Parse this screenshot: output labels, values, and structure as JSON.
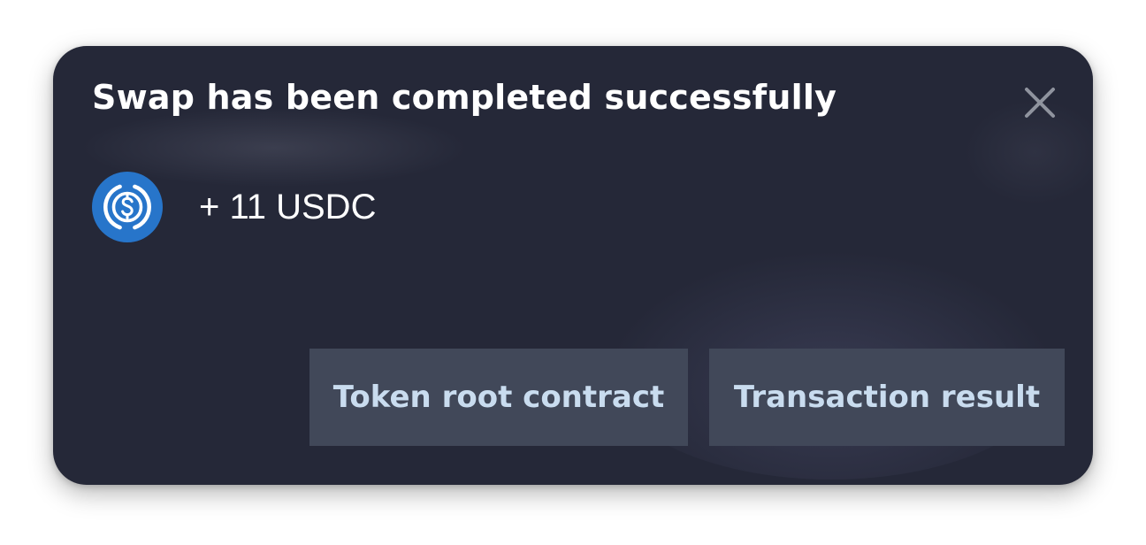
{
  "notification": {
    "title": "Swap has been completed successfully",
    "close_icon": "close-icon",
    "token": {
      "icon": "usdc-icon",
      "amount_text": "+ 11 USDC",
      "brand_color": "#2775CA"
    },
    "actions": {
      "token_root_label": "Token root contract",
      "transaction_label": "Transaction result"
    }
  },
  "colors": {
    "panel_background": "#252838",
    "button_background": "#414859",
    "button_text": "#C9DCEF",
    "title_text": "#FFFFFF",
    "close_icon": "#8F939E"
  }
}
